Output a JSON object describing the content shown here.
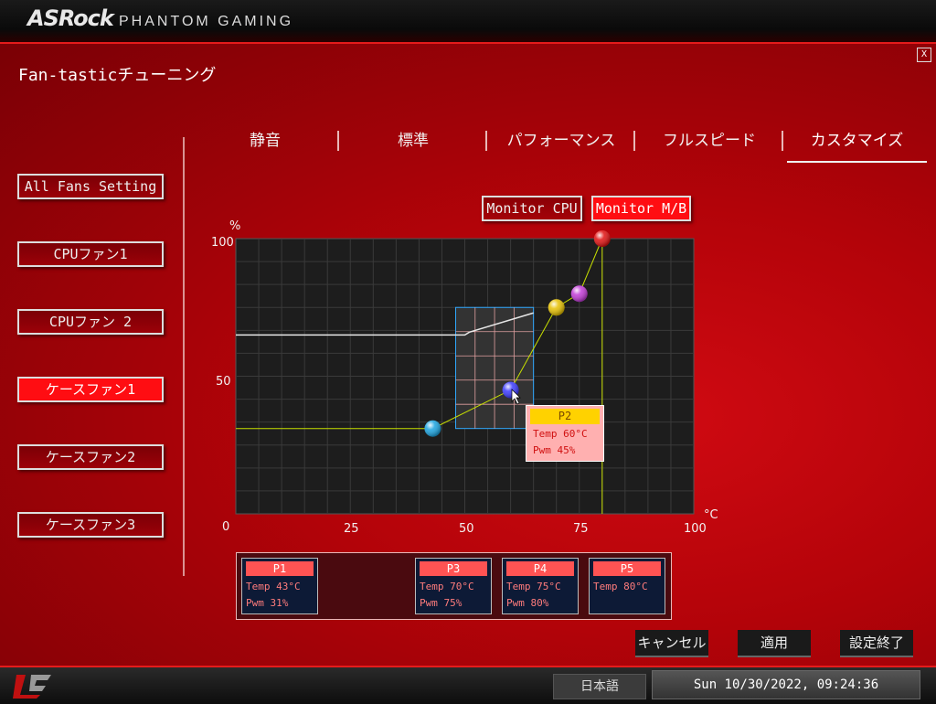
{
  "header": {
    "brand": "ASRock",
    "product": "PHANTOM GAMING"
  },
  "window": {
    "title": "Fan-tasticチューニング",
    "close_label": "X"
  },
  "fans": [
    {
      "label": "All Fans Setting",
      "active": false
    },
    {
      "label": "CPUファン1",
      "active": false
    },
    {
      "label": "CPUファン 2",
      "active": false
    },
    {
      "label": "ケースファン1",
      "active": true
    },
    {
      "label": "ケースファン2",
      "active": false
    },
    {
      "label": "ケースファン3",
      "active": false
    }
  ],
  "tabs": [
    {
      "label": "静音",
      "active": false
    },
    {
      "label": "標準",
      "active": false
    },
    {
      "label": "パフォーマンス",
      "active": false
    },
    {
      "label": "フルスピード",
      "active": false
    },
    {
      "label": "カスタマイズ",
      "active": true
    }
  ],
  "monitor": {
    "cpu_label": "Monitor CPU",
    "mb_label": "Monitor M/B",
    "active": "Monitor M/B"
  },
  "chart_data": {
    "type": "line",
    "xlabel": "°C",
    "ylabel": "%",
    "xlim": [
      0,
      100
    ],
    "ylim": [
      0,
      100
    ],
    "x_ticks": [
      "0",
      "25",
      "50",
      "75",
      "100"
    ],
    "y_ticks": [
      "100",
      "50"
    ],
    "grid": true,
    "points": [
      {
        "name": "P1",
        "temp": 43,
        "pwm": 31,
        "color": "#1aa3e0"
      },
      {
        "name": "P2",
        "temp": 60,
        "pwm": 45,
        "color": "#3a3aff"
      },
      {
        "name": "P3",
        "temp": 70,
        "pwm": 75,
        "color": "#e6c000"
      },
      {
        "name": "P4",
        "temp": 75,
        "pwm": 80,
        "color": "#c13ad6"
      },
      {
        "name": "P5",
        "temp": 80,
        "pwm": 100,
        "color": "#e01010"
      }
    ],
    "monitor_trace": [
      [
        0,
        65
      ],
      [
        50,
        65
      ],
      [
        51,
        66
      ],
      [
        65,
        73
      ]
    ]
  },
  "tooltip": {
    "title": "P2",
    "temp": "Temp 60°C",
    "pwm": "Pwm  45%"
  },
  "point_boxes": [
    {
      "title": "P1",
      "temp": "Temp 43°C",
      "pwm": "Pwm  31%"
    },
    {
      "title": "P3",
      "temp": "Temp 70°C",
      "pwm": "Pwm  75%"
    },
    {
      "title": "P4",
      "temp": "Temp 75°C",
      "pwm": "Pwm  80%"
    },
    {
      "title": "P5",
      "temp": "Temp 80°C",
      "pwm": ""
    }
  ],
  "buttons": {
    "cancel": "キャンセル",
    "apply": "適用",
    "finish": "設定終了"
  },
  "footer": {
    "language": "日本語",
    "datetime": "Sun 10/30/2022, 09:24:36"
  }
}
